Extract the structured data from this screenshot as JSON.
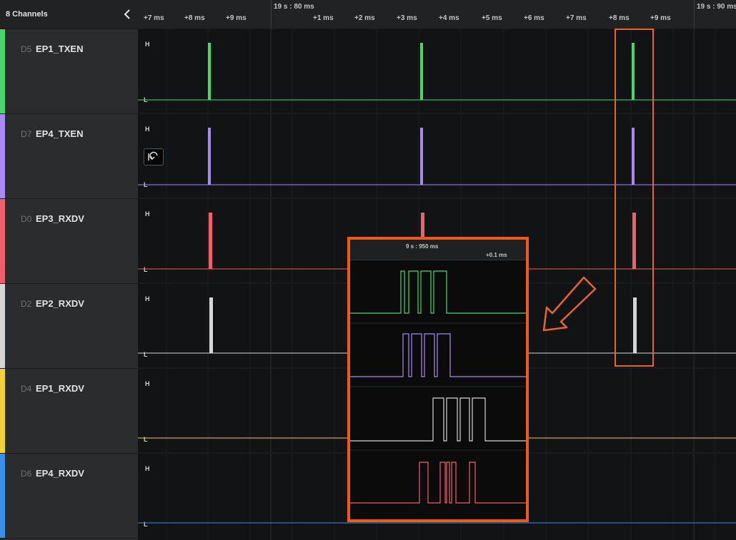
{
  "sidebar": {
    "title": "8 Channels",
    "collapse_icon": "chevron-left-icon",
    "channels": [
      {
        "device": "D5",
        "label": "EP1_TXEN",
        "color": "#4ad76a"
      },
      {
        "device": "D7",
        "label": "EP4_TXEN",
        "color": "#a78bf2"
      },
      {
        "device": "D0",
        "label": "EP3_RXDV",
        "color": "#f05f6c"
      },
      {
        "device": "D2",
        "label": "EP2_RXDV",
        "color": "#d6d6d6"
      },
      {
        "device": "D4",
        "label": "EP1_RXDV",
        "color": "#f2d23a"
      },
      {
        "device": "D6",
        "label": "EP4_RXDV",
        "color": "#3c8fe6"
      }
    ]
  },
  "timeline": {
    "ticks_left": [
      "+7 ms",
      "+8 ms",
      "+9 ms"
    ],
    "major_1": "19 s : 80 ms",
    "ticks_mid": [
      "+1 ms",
      "+2 ms",
      "+3 ms",
      "+4 ms",
      "+5 ms",
      "+6 ms",
      "+7 ms",
      "+8 ms",
      "+9 ms"
    ],
    "major_2": "19 s : 90 ms"
  },
  "waveform": {
    "high_label": "H",
    "low_label": "L",
    "undo_icon": "undo-icon"
  },
  "zoom_inset": {
    "major": "9 s : 950 ms",
    "tick": "+0.1 ms"
  },
  "annotation": {
    "arrow_icon": "arrow-down-left-icon",
    "highlight_color": "#e8642a"
  }
}
